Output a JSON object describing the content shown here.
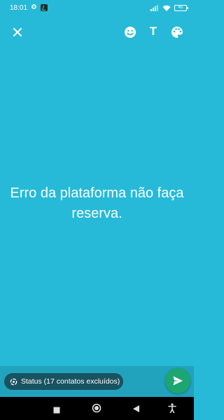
{
  "status_bar": {
    "time": "18:01",
    "battery": "45"
  },
  "toolbar": {
    "close_icon": "close-icon",
    "emoji_icon": "emoji-icon",
    "text_label": "T",
    "palette_icon": "palette-icon"
  },
  "message": {
    "text": "Erro da plataforma não faça reserva."
  },
  "composer": {
    "status_label": "Status (17 contatos excluídos)",
    "send_icon": "send-icon"
  },
  "colors": {
    "background": "#26bad8",
    "send_button": "#1da672"
  }
}
